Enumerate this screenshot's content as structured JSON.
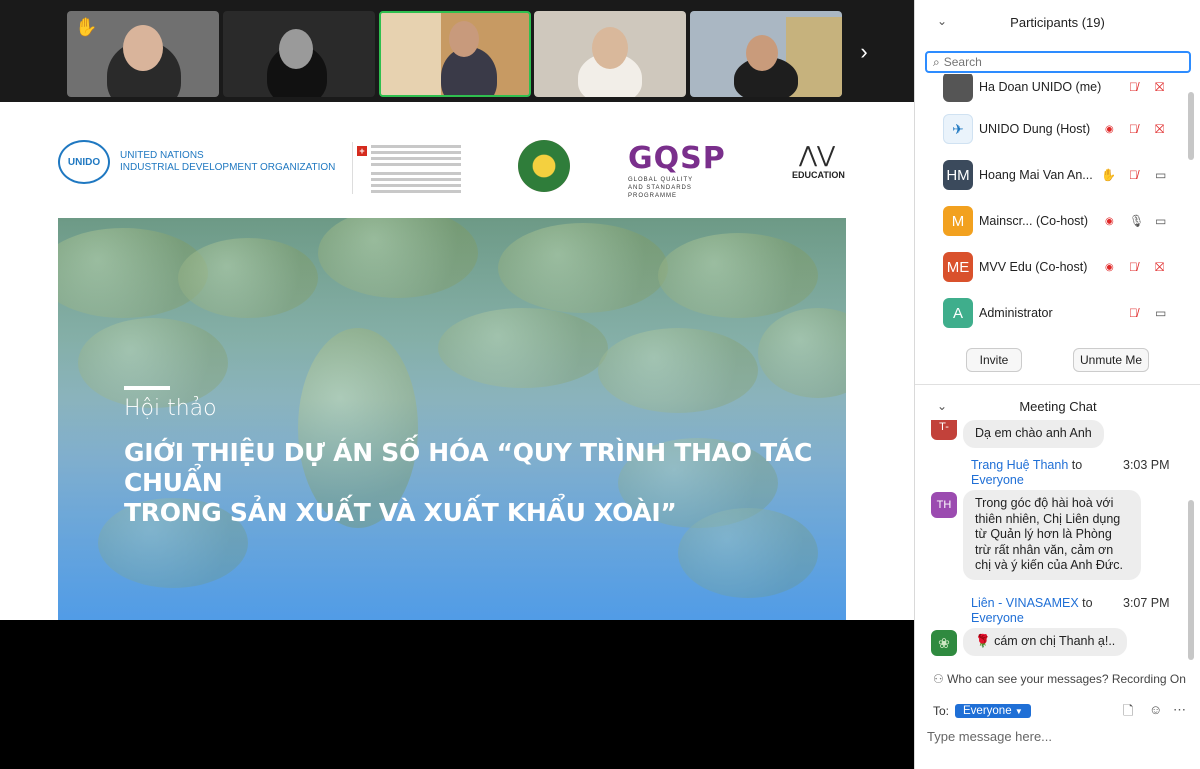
{
  "thumbnails": [
    {
      "bg": "#6f6f6f",
      "raised_hand": "✋"
    },
    {
      "bg": "#2e2e2e",
      "raised_hand": ""
    },
    {
      "bg": "#b08a5a",
      "raised_hand": ""
    },
    {
      "bg": "#c9c3b8",
      "raised_hand": ""
    },
    {
      "bg": "#a9b6c2",
      "raised_hand": ""
    }
  ],
  "slide": {
    "logos": {
      "unido_mark": "UNIDO",
      "unido_line1": "UNITED NATIONS",
      "unido_line2": "INDUSTRIAL DEVELOPMENT ORGANIZATION",
      "gqsp_letters": "GQSP",
      "gqsp_sub1": "GLOBAL QUALITY",
      "gqsp_sub2": "AND STANDARDS PROGRAMME",
      "mvv_text": "EDUCATION"
    },
    "subtitle": "Hội thảo",
    "title_line1": "GIỚI THIỆU DỰ ÁN SỐ HÓA “QUY TRÌNH THAO TÁC CHUẨN",
    "title_line2": "TRONG SẢN XUẤT VÀ XUẤT KHẨU XOÀI”"
  },
  "participants_panel": {
    "title": "Participants (19)",
    "search_placeholder": "Search",
    "participants": [
      {
        "name": "Ha Doan UNIDO (me)",
        "initials": "",
        "color": "#555555"
      },
      {
        "name": "UNIDO Dung (Host)",
        "initials": "",
        "color": "#eaf3fb"
      },
      {
        "name": "Hoang Mai Van An...",
        "initials": "HM",
        "color": "#3b4a5c"
      },
      {
        "name": "Mainscr...   (Co-host)",
        "initials": "M",
        "color": "#f2a11f"
      },
      {
        "name": "MVV Edu (Co-host)",
        "initials": "ME",
        "color": "#d9512c"
      },
      {
        "name": "Administrator",
        "initials": "A",
        "color": "#3fae8c"
      }
    ],
    "invite_label": "Invite",
    "unmute_label": "Unmute Me"
  },
  "chat": {
    "title": "Meeting Chat",
    "messages": [
      {
        "avatar": "T-",
        "avatar_color": "#c2413a",
        "text": "Dạ em chào anh Anh"
      },
      {
        "sender": "Trang Huệ Thanh",
        "to_word": "to",
        "recipient": "Everyone",
        "time": "3:03 PM",
        "avatar": "TH",
        "avatar_color": "#9b4bb0",
        "lines": [
          "Trong góc độ hài hoà với",
          "thiên nhiên, Chị Liên dụng",
          "từ Quản lý hơn là Phòng",
          "trừ rất nhân văn, cảm ơn",
          "chị và ý kiến của Anh Đức."
        ]
      },
      {
        "sender": "Liên - VINASAMEX",
        "to_word": "to",
        "recipient": "Everyone",
        "time": "3:07 PM",
        "avatar": "",
        "avatar_color": "#2f8a3f",
        "emoji": "🌹",
        "text": "cám ơn chị Thanh ạ!.."
      }
    ],
    "who_can_see": "Who can see your messages? Recording On",
    "to_label": "To:",
    "to_value": "Everyone",
    "input_placeholder": "Type message here..."
  }
}
